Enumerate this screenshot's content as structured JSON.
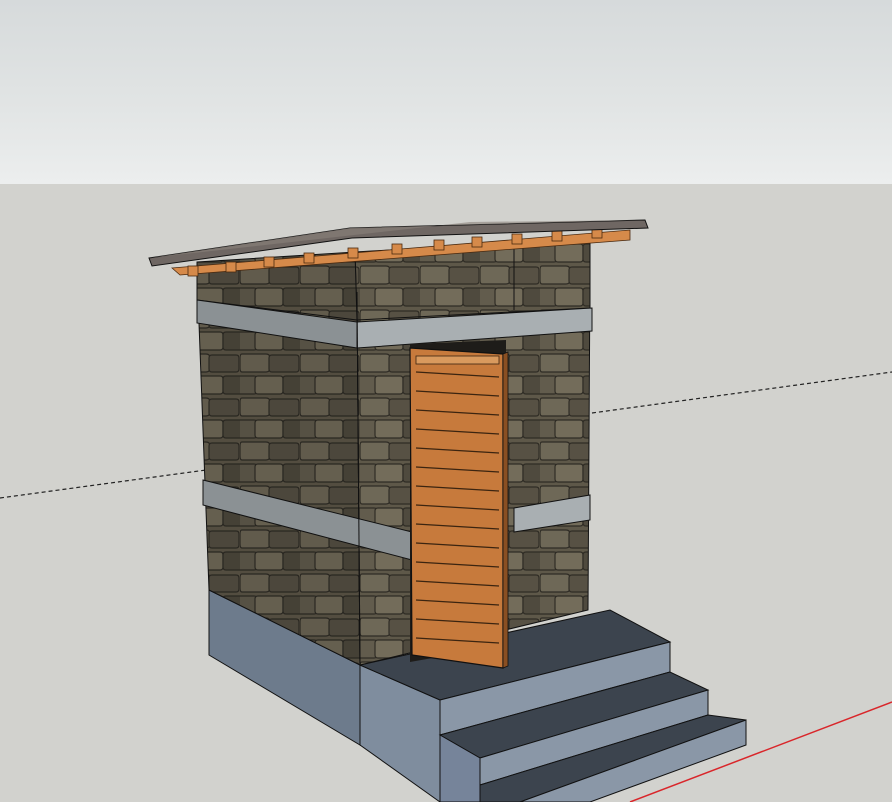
{
  "viewport": {
    "sky_color": "#e1e4e4",
    "ground_color": "#d2d2ce",
    "red_axis_color": "#d9262a",
    "axis_dash_color": "#222222"
  },
  "model": {
    "stone_color": "#5a5447",
    "concrete_band_color": "#a2a8ab",
    "plinth_color": "#7f8d9e",
    "plinth_shadow_color": "#5b6878",
    "steps_tread_color": "#3c444e",
    "steps_riser_color": "#8a97a7",
    "door_color": "#c77a3c",
    "roof_color": "#6f6763",
    "rafter_color": "#d68a4a"
  }
}
